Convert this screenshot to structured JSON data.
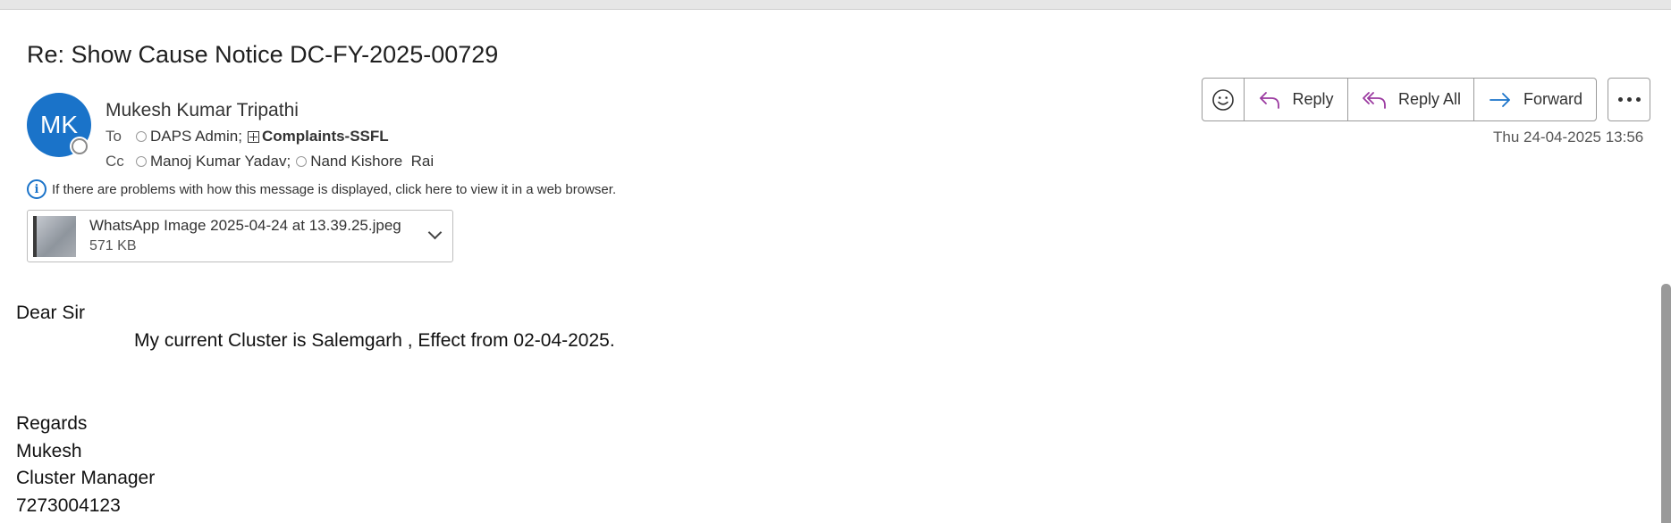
{
  "subject": "Re: Show Cause Notice DC-FY-2025-00729",
  "sender": {
    "initials": "MK",
    "name": "Mukesh Kumar Tripathi"
  },
  "to": {
    "label": "To",
    "recipients": [
      "DAPS Admin;",
      "Complaints-SSFL"
    ]
  },
  "cc": {
    "label": "Cc",
    "recipients": [
      "Manoj Kumar Yadav;",
      "Nand Kishore  Rai"
    ]
  },
  "info_bar": "If there are problems with how this message is displayed, click here to view it in a web browser.",
  "attachment": {
    "name": "WhatsApp Image 2025-04-24 at 13.39.25.jpeg",
    "size": "571 KB"
  },
  "actions": {
    "reply": "Reply",
    "reply_all": "Reply All",
    "forward": "Forward"
  },
  "timestamp": "Thu 24-04-2025 13:56",
  "body": {
    "greeting": "Dear Sir",
    "paragraph": "My current Cluster is Salemgarh , Effect from 02-04-2025.",
    "closing": "Regards",
    "sig_name": "Mukesh",
    "sig_title": "Cluster Manager",
    "sig_phone": "7273004123"
  }
}
